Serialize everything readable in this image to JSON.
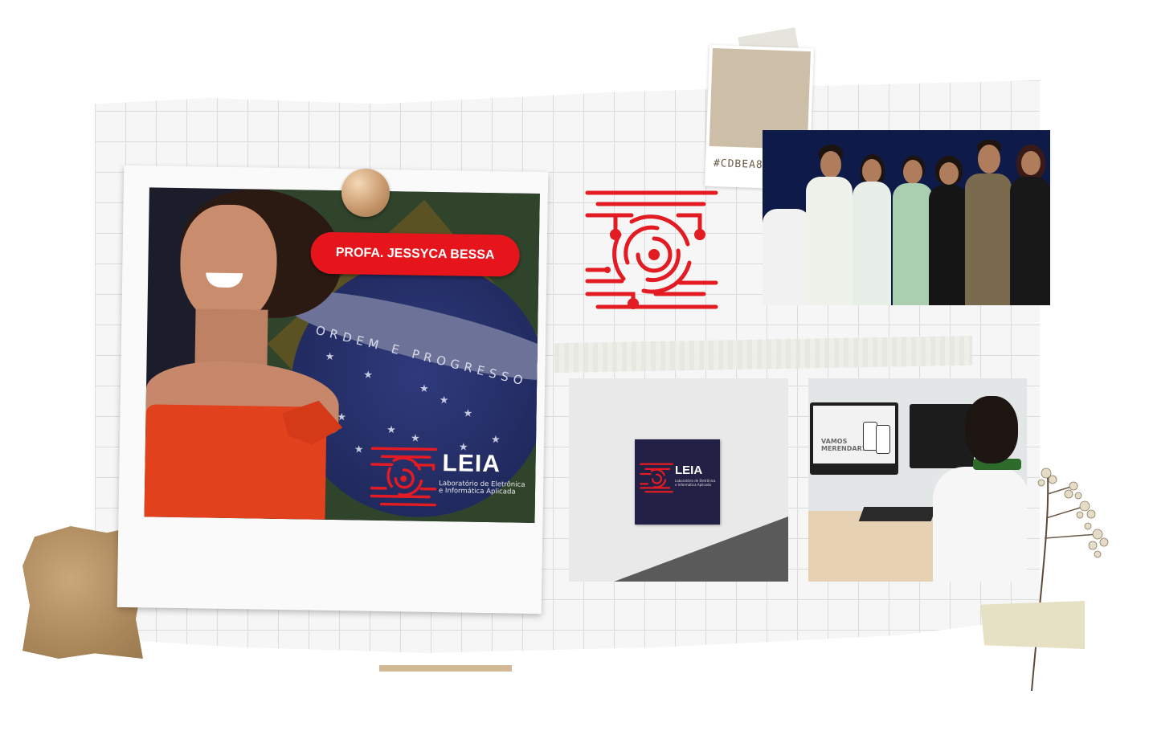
{
  "badge": {
    "name": "PROFA. JESSYCA BESSA"
  },
  "flag": {
    "motto": "ORDEM E PROGRESSO"
  },
  "logo": {
    "title": "LEIA",
    "subtitle": "Laboratório de Eletrônica e Informática Aplicada",
    "color": "#E31B23"
  },
  "swatch": {
    "hex_label": "#CDBEA8",
    "color": "#CDBEA8"
  },
  "lab_screen": {
    "heading": "VAMOS MERENDAR?"
  },
  "colors": {
    "accent_red": "#E6151C",
    "kraft": "#A88559",
    "team_background": "#0E1A47",
    "grid_line": "#DCDCDC"
  }
}
